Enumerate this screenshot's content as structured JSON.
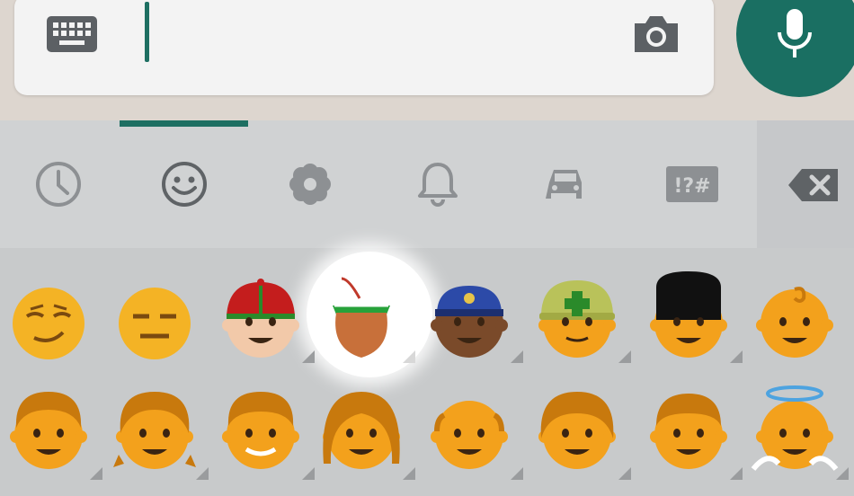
{
  "input": {
    "keyboard_icon": "keyboard-icon",
    "camera_icon": "camera-icon",
    "mic_icon": "mic-icon",
    "accent_color": "#1a6f62"
  },
  "tabs": {
    "active": "smileys",
    "items": [
      {
        "id": "recent",
        "icon": "clock-icon"
      },
      {
        "id": "smileys",
        "icon": "smiley-icon"
      },
      {
        "id": "nature",
        "icon": "flower-icon"
      },
      {
        "id": "objects",
        "icon": "bell-icon"
      },
      {
        "id": "places",
        "icon": "car-icon"
      },
      {
        "id": "symbols",
        "icon": "symbols-icon",
        "label": "!?#"
      }
    ],
    "backspace_icon": "backspace-icon"
  },
  "emoji": {
    "highlighted": "mate",
    "rows": [
      [
        "smirking-face",
        "expressionless-face",
        "man-with-gua-pi-mao",
        "mate",
        "police-officer",
        "rescue-worker-helmet",
        "guardsman",
        "baby"
      ],
      [
        "man",
        "girl",
        "older-man",
        "woman",
        "older-man-bald",
        "older-woman",
        "boy",
        "baby-angel"
      ]
    ]
  }
}
